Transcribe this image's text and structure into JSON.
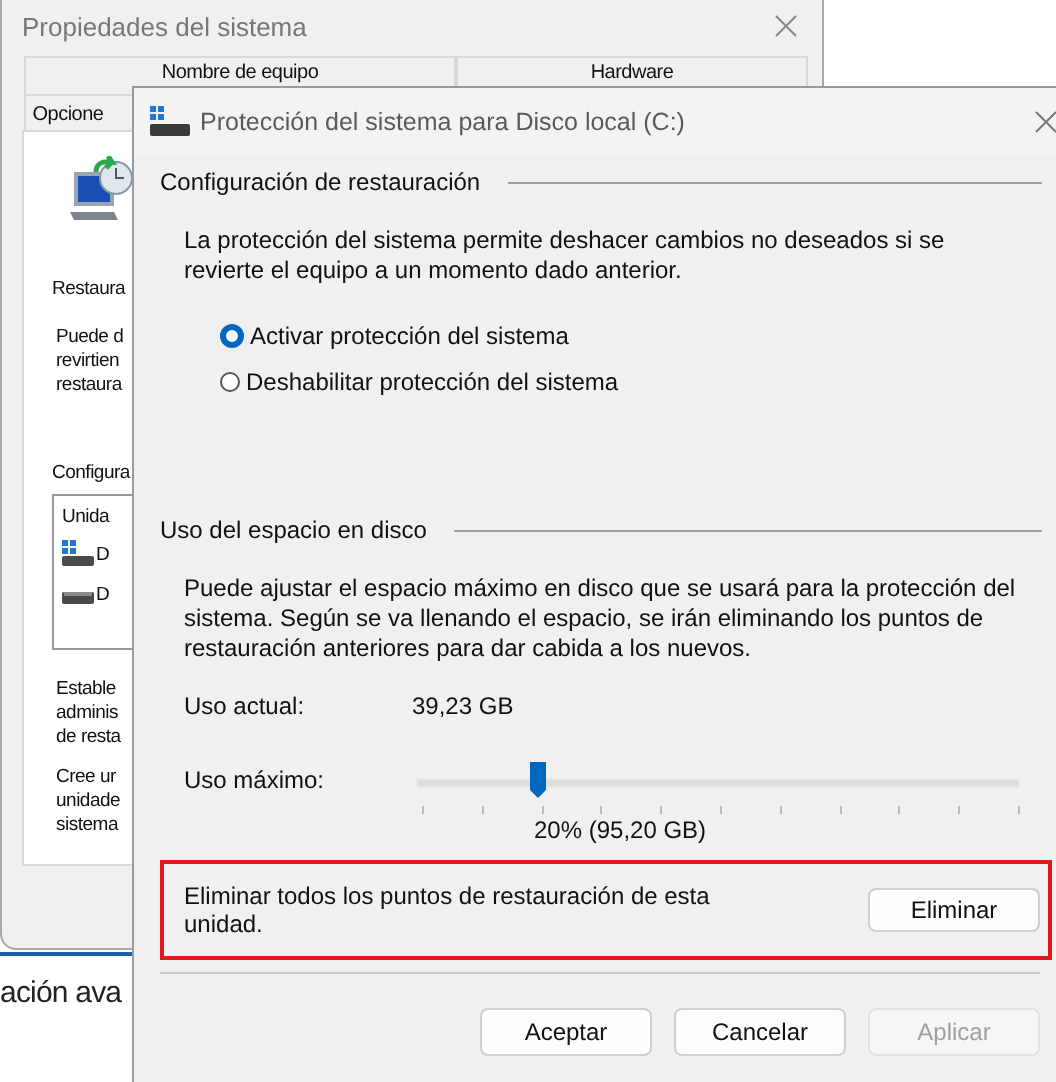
{
  "system_properties": {
    "title": "Propiedades del sistema",
    "tab_rows": [
      [
        {
          "label": "Nombre de equipo",
          "selected": false
        },
        {
          "label": "Hardware",
          "selected": false
        }
      ],
      [
        {
          "label": "Opcione",
          "selected": false
        }
      ]
    ],
    "section_label": "Restaura",
    "description_lines": [
      "Puede d",
      "revirtien",
      "restaura"
    ],
    "config_label": "Configura",
    "drive_list": {
      "header": "Unida",
      "items": [
        {
          "label": "D",
          "kind": "system"
        },
        {
          "label": "D",
          "kind": "disk"
        }
      ]
    },
    "notes": [
      [
        "Estable",
        "adminis",
        "de resta"
      ],
      [
        "Cree ur",
        "unidade",
        "sistema"
      ]
    ]
  },
  "behind_window": {
    "text": "ación ava"
  },
  "dialog": {
    "title": "Protección del sistema para Disco local (C:)",
    "restore_settings": {
      "heading": "Configuración de restauración",
      "description": "La protección del sistema permite deshacer cambios no deseados si se revierte el equipo a un momento dado anterior.",
      "options": [
        {
          "label": "Activar protección del sistema",
          "selected": true
        },
        {
          "label": "Deshabilitar protección del sistema",
          "selected": false
        }
      ]
    },
    "disk_usage": {
      "heading": "Uso del espacio en disco",
      "description": "Puede ajustar el espacio máximo en disco que se usará para la protección del sistema. Según se va llenando el espacio, se irán eliminando los puntos de restauración anteriores para dar cabida a los nuevos.",
      "current_label": "Uso actual:",
      "current_value": "39,23 GB",
      "max_label": "Uso máximo:",
      "slider": {
        "level": 0.2
      },
      "reading": "20% (95,20 GB)"
    },
    "delete": {
      "text": "Eliminar todos los puntos de restauración de esta unidad.",
      "button": "Eliminar"
    },
    "buttons": [
      {
        "label": "Aceptar",
        "disabled": false
      },
      {
        "label": "Cancelar",
        "disabled": false
      },
      {
        "label": "Aplicar",
        "disabled": true
      }
    ]
  }
}
